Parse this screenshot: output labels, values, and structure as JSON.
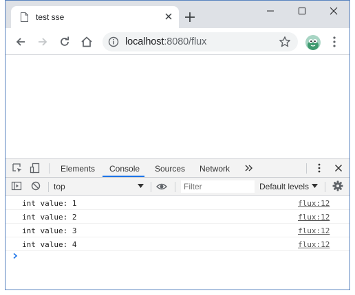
{
  "tab": {
    "title": "test sse"
  },
  "address": {
    "host": "localhost",
    "rest": ":8080/flux"
  },
  "devtools": {
    "tabs": [
      "Elements",
      "Console",
      "Sources",
      "Network"
    ],
    "active_tab": "Console",
    "context": "top",
    "filter_placeholder": "Filter",
    "levels": "Default levels"
  },
  "console": {
    "messages": [
      {
        "text": "int value: 1",
        "source": "flux:12"
      },
      {
        "text": "int value: 2",
        "source": "flux:12"
      },
      {
        "text": "int value: 3",
        "source": "flux:12"
      },
      {
        "text": "int value: 4",
        "source": "flux:12"
      }
    ]
  },
  "colors": {
    "accent": "#1a73e8",
    "titlebar": "#dee1e6",
    "devtools_bar": "#f3f3f3"
  }
}
